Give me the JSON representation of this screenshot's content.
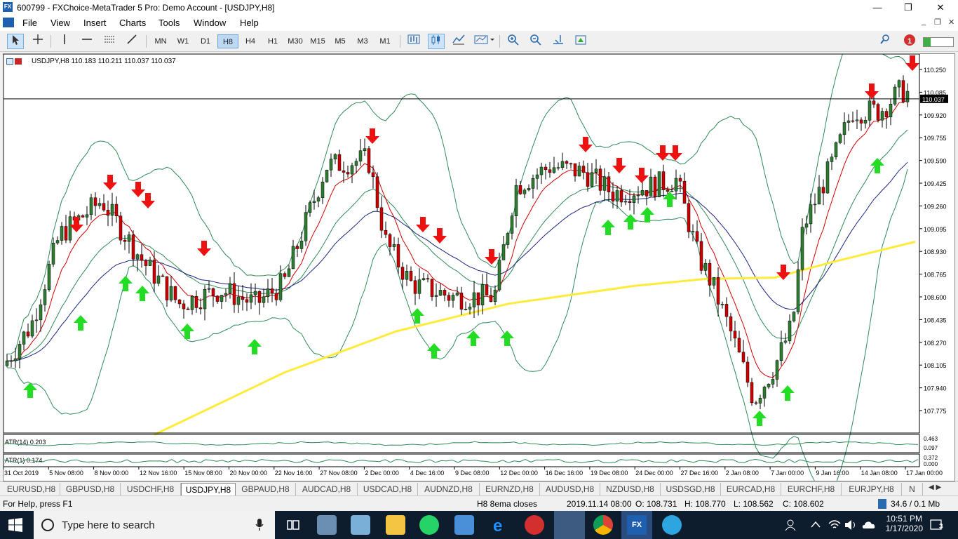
{
  "window": {
    "title": "600799 - FXChoice-MetaTrader 5 Pro: Demo Account - [USDJPY,H8]",
    "app_icon": "FX",
    "minimize": "—",
    "restore": "❐",
    "close": "✕"
  },
  "menu": {
    "items": [
      "File",
      "View",
      "Insert",
      "Charts",
      "Tools",
      "Window",
      "Help"
    ],
    "mdi_min": "_",
    "mdi_restore": "❐",
    "mdi_close": "✕"
  },
  "toolbar": {
    "timeframes": [
      "MN",
      "W1",
      "D1",
      "H8",
      "H4",
      "H1",
      "M30",
      "M15",
      "M5",
      "M3",
      "M1"
    ],
    "active_timeframe": "H8",
    "notification_count": "1"
  },
  "chart": {
    "header": "USDJPY,H8  110.183 110.211 110.037 110.037",
    "current_price_label": "110.037",
    "price_axis": [
      "110.250",
      "110.085",
      "109.920",
      "109.755",
      "109.590",
      "109.425",
      "109.260",
      "109.095",
      "108.930",
      "108.765",
      "108.600",
      "108.435",
      "108.270",
      "108.105",
      "107.940",
      "107.775"
    ],
    "time_axis": [
      "31 Oct 2019",
      "5 Nov 08:00",
      "8 Nov 00:00",
      "12 Nov 16:00",
      "15 Nov 08:00",
      "20 Nov 00:00",
      "22 Nov 16:00",
      "27 Nov 08:00",
      "2 Dec 00:00",
      "4 Dec 16:00",
      "9 Dec 08:00",
      "12 Dec 00:00",
      "16 Dec 16:00",
      "19 Dec 08:00",
      "24 Dec 00:00",
      "27 Dec 16:00",
      "2 Jan 08:00",
      "7 Jan 00:00",
      "9 Jan 16:00",
      "14 Jan 08:00",
      "17 Jan 00:00"
    ],
    "atr14_label": "ATR(14) 0.203",
    "atr14_axis": [
      "0.463",
      "0.097"
    ],
    "atr1_label": "ATR(1) 0.174",
    "atr1_axis": [
      "0.372",
      "0.000"
    ],
    "colors": {
      "bull_candle": "#2e7d32",
      "bear_candle": "#cc0000",
      "bollinger": "#2e8b57",
      "ema_fast": "#d00000",
      "ema_mid": "#1a237e",
      "ema_slow": "#ffeb3b",
      "up_arrow": "#22dd22",
      "down_arrow": "#ee1111"
    }
  },
  "tabs": {
    "items": [
      "EURUSD,H8",
      "GBPUSD,H8",
      "USDCHF,H8",
      "USDJPY,H8",
      "GBPAUD,H8",
      "AUDCAD,H8",
      "USDCAD,H8",
      "AUDNZD,H8",
      "EURNZD,H8",
      "AUDUSD,H8",
      "NZDUSD,H8",
      "USDSGD,H8",
      "EURCAD,H8",
      "EURCHF,H8",
      "EURJPY,H8",
      "N"
    ],
    "active": "USDJPY,H8"
  },
  "status": {
    "help": "For Help, press F1",
    "profile": "H8 8ema closes",
    "datetime": "2019.11.14 08:00",
    "open": "O: 108.731",
    "high": "H: 108.770",
    "low": "L: 108.562",
    "close": "C: 108.602",
    "traffic": "34.6 / 0.1 Mb"
  },
  "taskbar": {
    "search_placeholder": "Type here to search",
    "time": "10:51 PM",
    "date": "1/17/2020",
    "notification_count": "3"
  }
}
